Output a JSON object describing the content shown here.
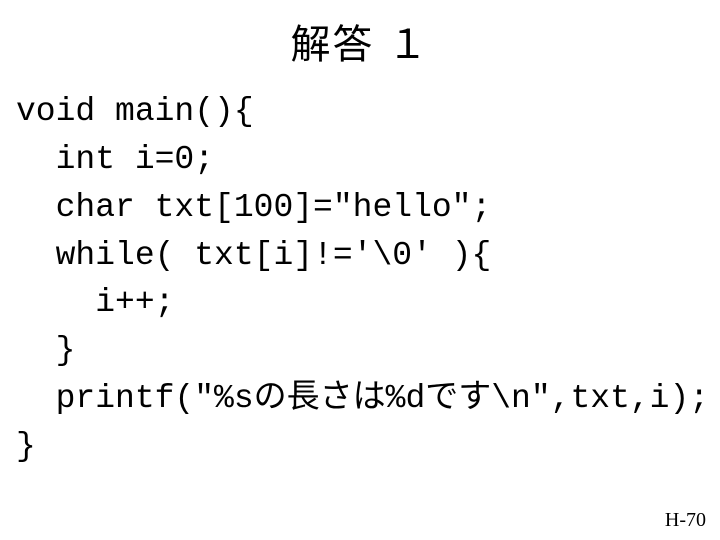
{
  "title": "解答 １",
  "code": {
    "line1": "void main(){",
    "line2": "  int i=0;",
    "line3": "  char txt[100]=\"hello\";",
    "line4": "  while( txt[i]!='\\0' ){",
    "line5": "    i++;",
    "line6": "  }",
    "line7": "  printf(\"%sの長さは%dです\\n\",txt,i);",
    "line8": "}"
  },
  "page_number": "H-70"
}
